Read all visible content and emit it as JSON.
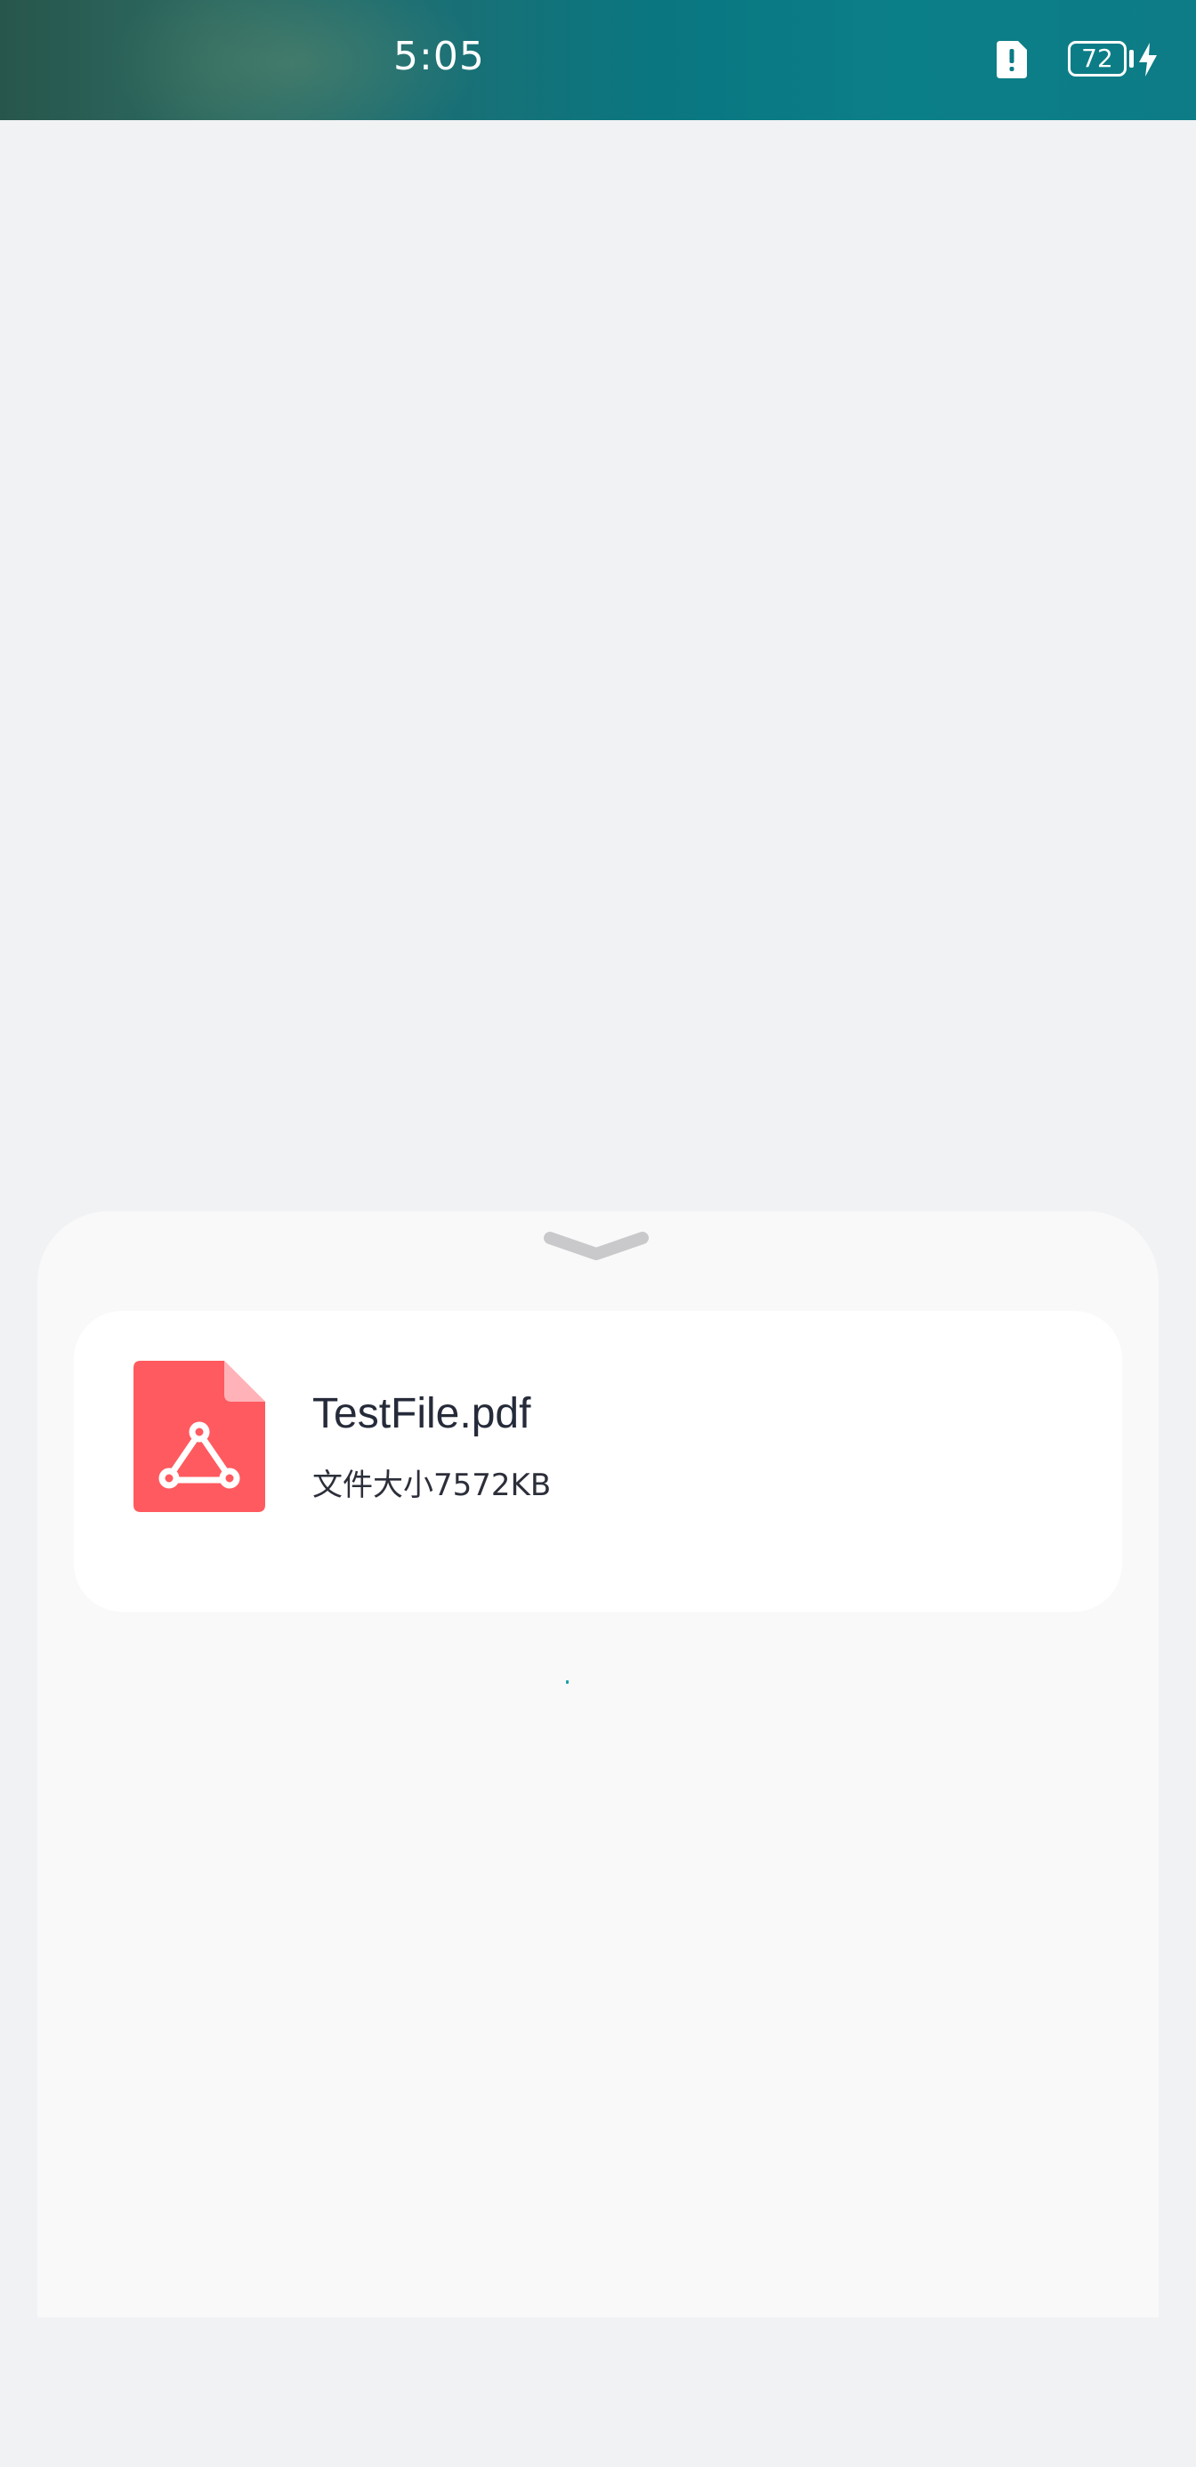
{
  "status_bar": {
    "time": "5:05",
    "battery_level": "72",
    "icons": [
      "sim-alert-icon",
      "battery-icon",
      "charging-icon"
    ]
  },
  "sheet": {
    "handle_icon": "chevron-down-icon",
    "file": {
      "icon": "pdf-file-icon",
      "name": "TestFile.pdf",
      "size_text": "文件大小7572KB"
    }
  },
  "colors": {
    "pdf_icon": "#ff5a5f",
    "pdf_corner": "#ffb3b8",
    "background": "#f1f2f4",
    "sheet": "#f9f9fa",
    "card": "#ffffff",
    "accent": "#1ba0a6"
  }
}
